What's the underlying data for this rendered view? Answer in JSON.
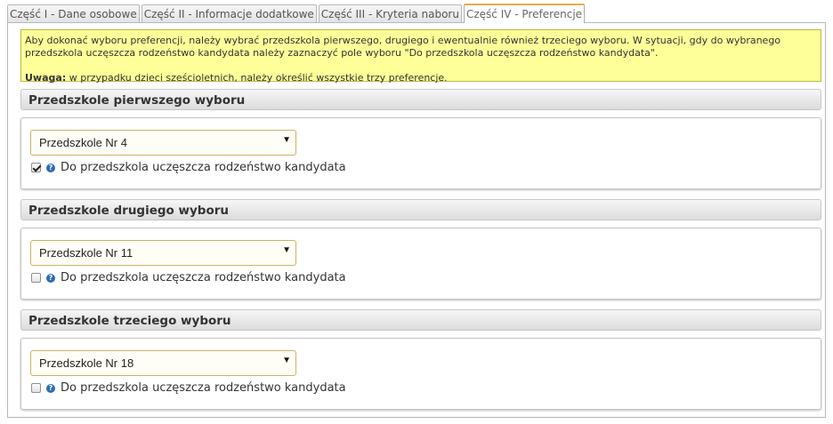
{
  "tabs": [
    {
      "label": "Część I - Dane osobowe"
    },
    {
      "label": "Część II - Informacje dodatkowe"
    },
    {
      "label": "Część III - Kryteria naboru"
    },
    {
      "label": "Część IV - Preferencje",
      "active": true
    }
  ],
  "info": {
    "text": "Aby dokonać wyboru preferencji, należy wybrać przedszkola pierwszego, drugiego i ewentualnie również trzeciego wyboru. W sytuacji, gdy do wybranego przedszkola uczęszcza rodzeństwo kandydata należy zaznaczyć pole wyboru \"Do przedszkola uczęszcza rodzeństwo kandydata\".",
    "warning_label": "Uwaga:",
    "warning_text": " w przypadku dzieci sześcioletnich, należy określić wszystkie trzy preferencje."
  },
  "sections": [
    {
      "title": "Przedszkole pierwszego wyboru",
      "selected": "Przedszkole Nr 4",
      "sibling_label": "Do przedszkola uczęszcza rodzeństwo kandydata",
      "sibling_checked": true
    },
    {
      "title": "Przedszkole drugiego wyboru",
      "selected": "Przedszkole Nr 11",
      "sibling_label": "Do przedszkola uczęszcza rodzeństwo kandydata",
      "sibling_checked": false
    },
    {
      "title": "Przedszkole trzeciego wyboru",
      "selected": "Przedszkole Nr 18",
      "sibling_label": "Do przedszkola uczęszcza rodzeństwo kandydata",
      "sibling_checked": false
    }
  ],
  "icons": {
    "help": "help-question-icon",
    "dropdown": "dropdown-arrow-icon"
  },
  "colors": {
    "info_bg": "#ffff99",
    "active_tab_accent": "#f0a94b",
    "help_icon": "#2a6db5"
  }
}
